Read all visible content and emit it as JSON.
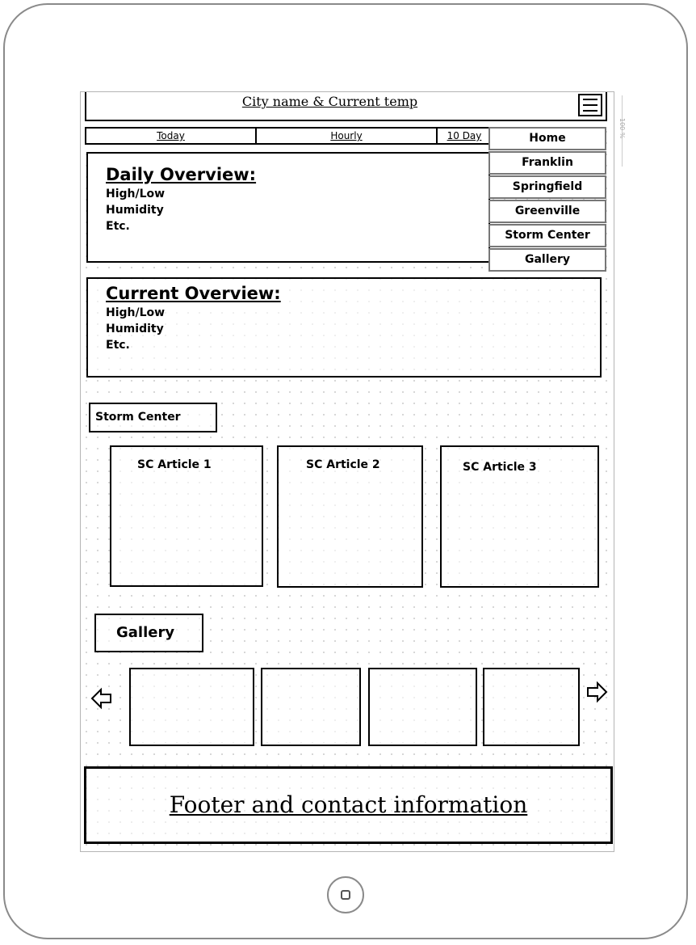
{
  "header": {
    "title": "City name & Current temp",
    "menu_icon": "hamburger-icon"
  },
  "tabs": [
    {
      "label": "Today"
    },
    {
      "label": "Hourly"
    },
    {
      "label": "10 Day"
    }
  ],
  "nav_menu": {
    "items": [
      {
        "label": "Home"
      },
      {
        "label": "Franklin"
      },
      {
        "label": "Springfield"
      },
      {
        "label": "Greenville"
      },
      {
        "label": "Storm Center"
      },
      {
        "label": "Gallery"
      }
    ]
  },
  "daily_overview": {
    "title": "Daily Overview:",
    "lines": [
      "High/Low",
      "Humidity",
      "Etc."
    ]
  },
  "current_overview": {
    "title": "Current Overview:",
    "lines": [
      "High/Low",
      "Humidity",
      "Etc."
    ]
  },
  "storm_center": {
    "label": "Storm Center",
    "articles": [
      {
        "title": "SC Article 1"
      },
      {
        "title": "SC Article 2"
      },
      {
        "title": "SC Article 3"
      }
    ]
  },
  "gallery": {
    "label": "Gallery",
    "prev_icon": "left-arrow-icon",
    "next_icon": "right-arrow-icon"
  },
  "footer": {
    "text": "Footer and contact information"
  },
  "side_ruler": {
    "text": "100 %"
  }
}
